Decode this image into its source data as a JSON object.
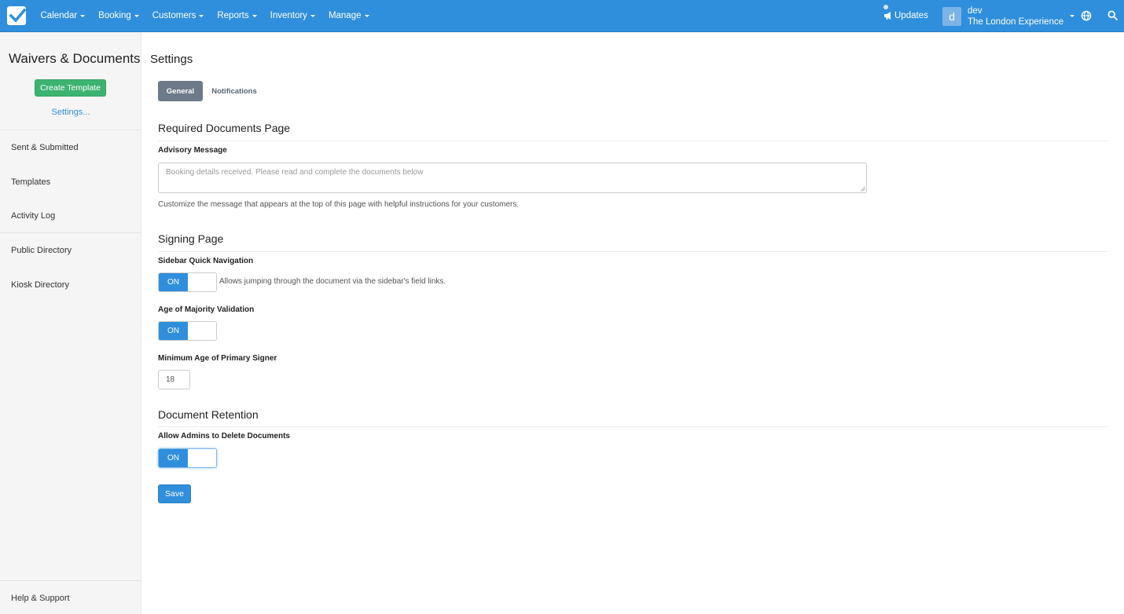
{
  "nav": {
    "items": [
      {
        "label": "Calendar"
      },
      {
        "label": "Booking"
      },
      {
        "label": "Customers"
      },
      {
        "label": "Reports"
      },
      {
        "label": "Inventory"
      },
      {
        "label": "Manage"
      }
    ],
    "updates_label": "Updates",
    "user": {
      "avatar_letter": "d",
      "name": "dev",
      "org": "The London Experience"
    },
    "brand_color": "#2f8fdc"
  },
  "sidebar": {
    "title": "Waivers & Documents",
    "create_button": "Create Template",
    "settings_link": "Settings...",
    "items": [
      {
        "label": "Sent & Submitted"
      },
      {
        "label": "Templates"
      },
      {
        "label": "Activity Log"
      },
      {
        "label": "Public Directory"
      },
      {
        "label": "Kiosk Directory"
      }
    ],
    "footer": "Help & Support"
  },
  "main": {
    "title": "Settings",
    "tabs": [
      {
        "label": "General",
        "active": true
      },
      {
        "label": "Notifications",
        "active": false
      }
    ],
    "required_docs": {
      "title": "Required Documents Page",
      "advisory_label": "Advisory Message",
      "advisory_placeholder": "Booking details received. Please read and complete the documents below",
      "advisory_value": "",
      "help": "Customize the message that appears at the top of this page with helpful instructions for your customers."
    },
    "signing": {
      "title": "Signing Page",
      "sidebar_nav_label": "Sidebar Quick Navigation",
      "sidebar_nav_state": "ON",
      "sidebar_nav_desc": "Allows jumping through the document via the sidebar's field links.",
      "age_validation_label": "Age of Majority Validation",
      "age_validation_state": "ON",
      "min_age_label": "Minimum Age of Primary Signer",
      "min_age_value": "18"
    },
    "retention": {
      "title": "Document Retention",
      "allow_delete_label": "Allow Admins to Delete Documents",
      "allow_delete_state": "ON"
    },
    "save_label": "Save"
  }
}
